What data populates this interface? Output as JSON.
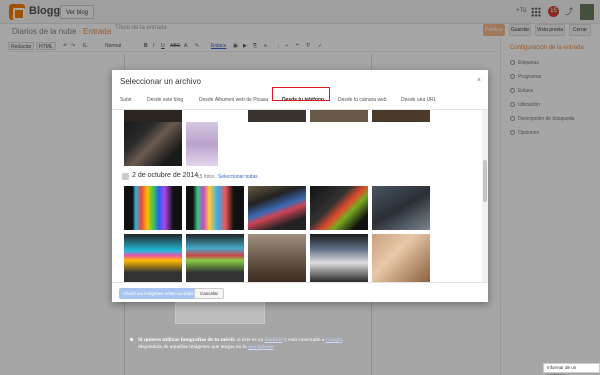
{
  "topbar": {
    "brand": "Blogger",
    "view_blog": "Ver blog",
    "plus_one": "+Tú",
    "notification_count": "15"
  },
  "post": {
    "blog_name": "Diarios de la nube",
    "section": "Entrada",
    "title_placeholder": "Título de la entrada",
    "actions": {
      "publish": "Publicar",
      "save": "Guardar",
      "preview": "Vista previa",
      "close": "Cerrar"
    }
  },
  "toolbar": {
    "compose": "Redactar",
    "html": "HTML",
    "font": "Normal",
    "link": "Enlace"
  },
  "right_panel": {
    "heading": "Configuración de la entrada",
    "items": [
      "Etiquetas",
      "Programar",
      "Enlace",
      "Ubicación",
      "Descripción de búsqueda",
      "Opciones"
    ]
  },
  "dialog": {
    "title": "Seleccionar un archivo",
    "close": "×",
    "tabs": [
      "Subir",
      "Desde este blog",
      "Desde Álbumes web de Picasa",
      "Desde tu teléfono",
      "Desde tu cámara web",
      "Desde una URL"
    ],
    "active_tab_index": 3,
    "group": {
      "date": "2 de octubre de 2014",
      "count": "15 fotos",
      "select_all": "Seleccionar todas"
    },
    "footer": {
      "add_selected": "Añadir las imágenes seleccionadas",
      "cancel": "Cancelar"
    }
  },
  "post_body": {
    "bold_intro": "Si quieres utilizar fotografías de tu móvil:",
    "text_1": " si éste es un ",
    "link_android": "Android",
    "text_2": " y está conectado a ",
    "link_google": "Google",
    "text_3": ", dispondrás de aquellas imágenes que tengas en la ",
    "link_photos": "quickphone",
    "text_4": "."
  },
  "report_button": "Informar de un problema",
  "colors": {
    "accent": "#f58a3a",
    "highlight": "#d81e1e",
    "link": "#3366cc"
  }
}
